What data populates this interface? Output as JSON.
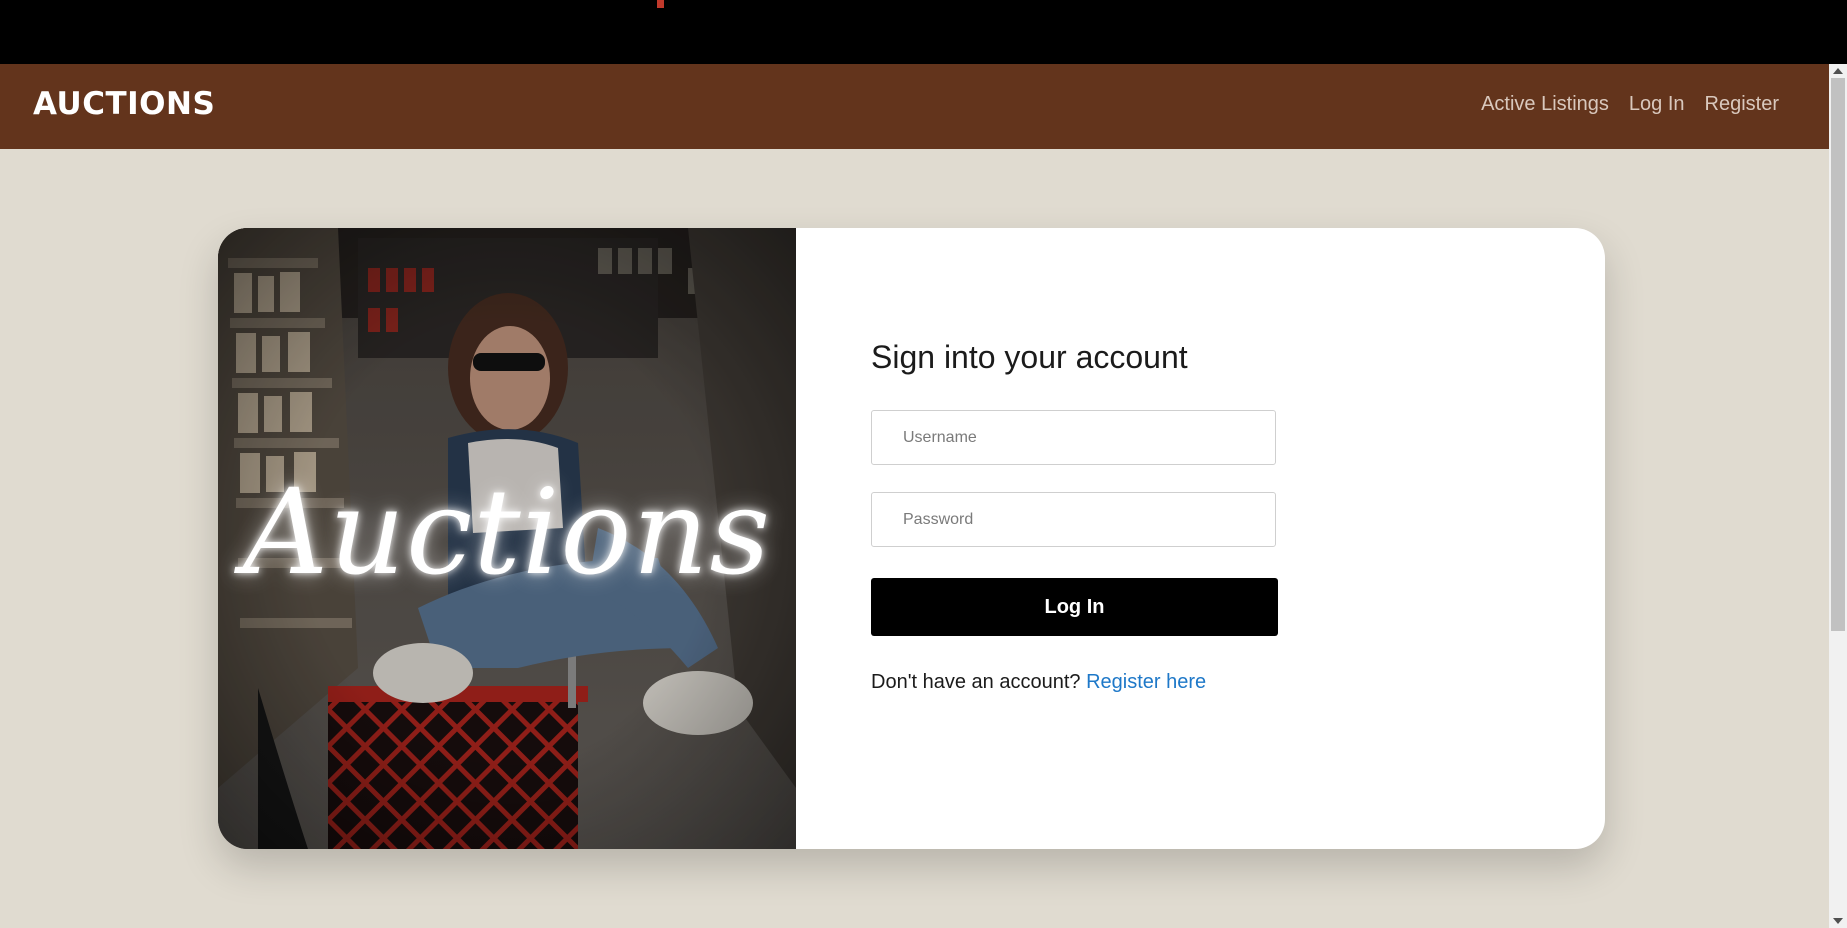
{
  "navbar": {
    "brand": "AUCTIONS",
    "links": [
      {
        "label": "Active Listings"
      },
      {
        "label": "Log In"
      },
      {
        "label": "Register"
      }
    ]
  },
  "hero": {
    "title": "Auctions"
  },
  "login": {
    "title": "Sign into your account",
    "username_placeholder": "Username",
    "password_placeholder": "Password",
    "submit_label": "Log In",
    "register_prompt": "Don't have an account? ",
    "register_link": "Register here"
  },
  "colors": {
    "navbar_bg": "#63341c",
    "page_bg": "#e0dbd0",
    "link_accent": "#1e78c8",
    "button_bg": "#000000"
  }
}
